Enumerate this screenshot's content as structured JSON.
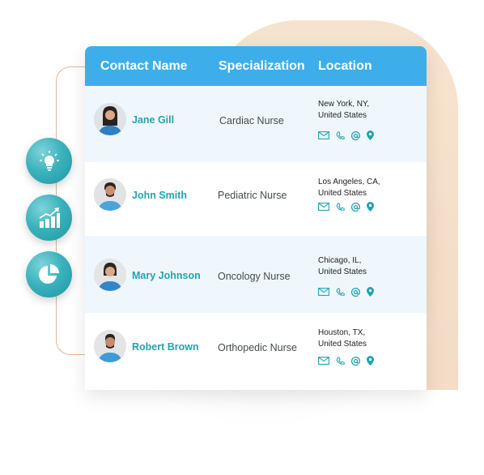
{
  "table": {
    "headers": {
      "contact_name": "Contact Name",
      "specialization": "Specialization",
      "location": "Location"
    },
    "rows": [
      {
        "name": "Jane Gill",
        "specialization": "Cardiac Nurse",
        "location_line1": "New York, NY,",
        "location_line2": "United States"
      },
      {
        "name": "John Smith",
        "specialization": "Pediatric Nurse",
        "location_line1": "Los Angeles, CA,",
        "location_line2": "United States"
      },
      {
        "name": "Mary Johnson",
        "specialization": "Oncology Nurse",
        "location_line1": "Chicago, IL,",
        "location_line2": "United States"
      },
      {
        "name": "Robert Brown",
        "specialization": "Orthopedic Nurse",
        "location_line1": "Houston, TX,",
        "location_line2": "United States"
      }
    ],
    "contact_icons": [
      "mail-icon",
      "phone-icon",
      "at-sign-icon",
      "map-pin-icon"
    ]
  },
  "side_bubbles": [
    "lightbulb-icon",
    "growth-chart-icon",
    "pie-chart-icon"
  ],
  "colors": {
    "header_bg": "#3daee9",
    "name_text": "#22a3b1",
    "icon_teal": "#22a3b1",
    "alt_row_bg": "#eff7fd",
    "peach_bg": "#f6e3cf",
    "connector": "#eab48e"
  }
}
